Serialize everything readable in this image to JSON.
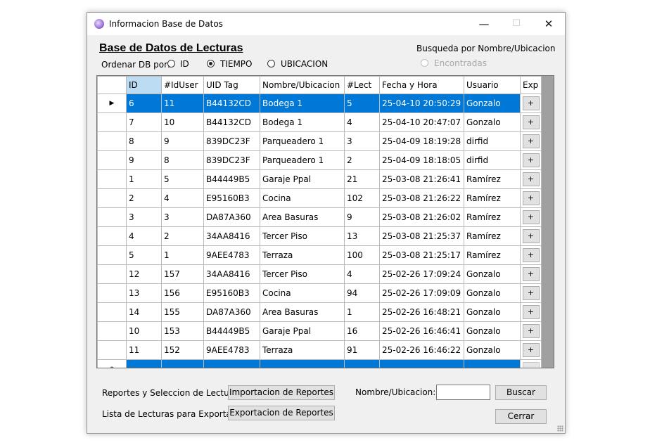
{
  "window": {
    "title": "Informacion Base de Datos",
    "icon": "app-icon",
    "controls": {
      "minimize": "—",
      "maximize": "☐",
      "close": "✕"
    }
  },
  "heading": "Base de Datos de Lecturas",
  "order": {
    "label": "Ordenar DB por:",
    "options": [
      "ID",
      "TIEMPO",
      "UBICACION"
    ],
    "selected": "TIEMPO"
  },
  "search_mode": {
    "label": "Busqueda por Nombre/Ubicacion",
    "found_option": "Encontradas",
    "found_enabled": false
  },
  "grid": {
    "columns": [
      "ID",
      "#IdUser",
      "UID Tag",
      "Nombre/Ubicacion",
      "#Lect",
      "Fecha y Hora",
      "Usuario",
      "Exp"
    ],
    "sorted_column": "ID",
    "current_row_marker": "▶",
    "new_row_marker": "*",
    "row_button_label": "+",
    "selected_row": 0,
    "rows": [
      [
        "6",
        "11",
        "B44132CD",
        "Bodega 1",
        "5",
        "25-04-10 20:50:29",
        "Gonzalo"
      ],
      [
        "7",
        "10",
        "B44132CD",
        "Bodega 1",
        "4",
        "25-04-10 20:47:07",
        "Gonzalo"
      ],
      [
        "8",
        "9",
        "839DC23F",
        "Parqueadero 1",
        "3",
        "25-04-09 18:19:28",
        "dirfid"
      ],
      [
        "9",
        "8",
        "839DC23F",
        "Parqueadero 1",
        "2",
        "25-04-09 18:18:05",
        "dirfid"
      ],
      [
        "1",
        "5",
        "B44449B5",
        "Garaje Ppal",
        "21",
        "25-03-08 21:26:41",
        "Ramírez"
      ],
      [
        "2",
        "4",
        "E95160B3",
        "Cocina",
        "102",
        "25-03-08 21:26:22",
        "Ramírez"
      ],
      [
        "3",
        "3",
        "DA87A360",
        "Area Basuras",
        "9",
        "25-03-08 21:26:02",
        "Ramírez"
      ],
      [
        "4",
        "2",
        "34AA8416",
        "Tercer Piso",
        "13",
        "25-03-08 21:25:37",
        "Ramírez"
      ],
      [
        "5",
        "1",
        "9AEE4783",
        "Terraza",
        "100",
        "25-03-08 21:25:17",
        "Ramírez"
      ],
      [
        "12",
        "157",
        "34AA8416",
        "Tercer Piso",
        "4",
        "25-02-26 17:09:24",
        "Gonzalo"
      ],
      [
        "13",
        "156",
        "E95160B3",
        "Cocina",
        "94",
        "25-02-26 17:09:09",
        "Gonzalo"
      ],
      [
        "14",
        "155",
        "DA87A360",
        "Area Basuras",
        "1",
        "25-02-26 16:48:21",
        "Gonzalo"
      ],
      [
        "10",
        "153",
        "B44449B5",
        "Garaje Ppal",
        "16",
        "25-02-26 16:46:41",
        "Gonzalo"
      ],
      [
        "11",
        "152",
        "9AEE4783",
        "Terraza",
        "91",
        "25-02-26 16:46:22",
        "Gonzalo"
      ]
    ]
  },
  "bottom": {
    "reports_label": "Reportes y Seleccion de Lecturas",
    "import_button": "Importacion de Reportes",
    "export_label": "Lista de Lecturas para Exportar",
    "export_button": "Exportacion de Reportes",
    "name_label": "Nombre/Ubicacion:",
    "name_value": "",
    "search_button": "Buscar",
    "close_button": "Cerrar"
  },
  "colors": {
    "selection": "#0078d7",
    "sorted_header": "#bcdcf4",
    "window_bg": "#f0f0f0",
    "grid_empty_area": "#a0a0a0"
  }
}
